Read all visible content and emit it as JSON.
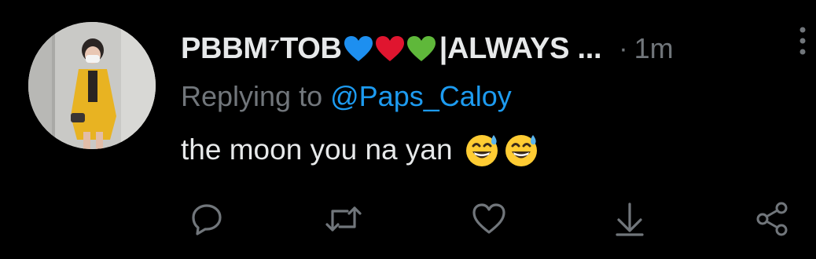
{
  "tweet": {
    "display_name_prefix": "PBBM⁷TOB",
    "display_name_suffix": "|ALWAYS ...",
    "separator": "·",
    "time": "1m",
    "reply_prefix": "Replying to ",
    "reply_mention": "@Paps_Caloy",
    "text": "the moon you na yan",
    "emojis": [
      "grinning-sweat-emoji",
      "grinning-sweat-emoji"
    ],
    "heart_colors": [
      "#1d8ff0",
      "#e0152f",
      "#5fb83a"
    ]
  },
  "actions": [
    {
      "icon": "reply-icon"
    },
    {
      "icon": "retweet-icon"
    },
    {
      "icon": "like-icon"
    },
    {
      "icon": "download-icon"
    },
    {
      "icon": "share-icon"
    }
  ],
  "colors": {
    "background": "#000000",
    "primary_text": "#e7e9ea",
    "secondary_text": "#71767b",
    "accent": "#1d9bf0"
  }
}
